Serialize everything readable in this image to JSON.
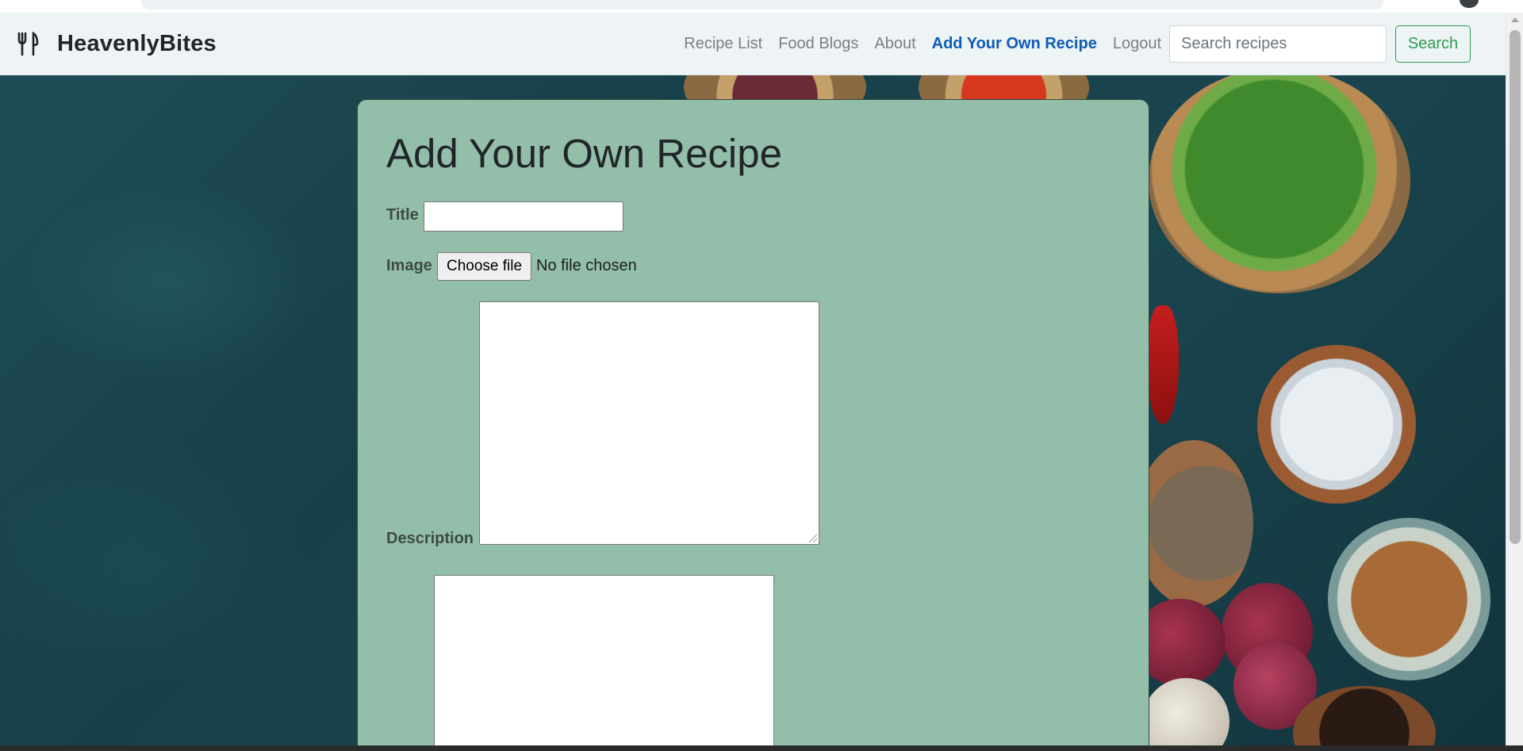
{
  "nav": {
    "brand_name": "HeavenlyBites",
    "brand_icon": "fork-knife-icon",
    "links": [
      {
        "label": "Recipe List"
      },
      {
        "label": "Food Blogs"
      },
      {
        "label": "About"
      },
      {
        "label": "Add Your Own Recipe",
        "active": true
      },
      {
        "label": "Logout"
      }
    ],
    "search_placeholder": "Search recipes",
    "search_value": "",
    "search_button": "Search"
  },
  "form": {
    "heading": "Add Your Own Recipe",
    "title_label": "Title",
    "title_value": "",
    "image_label": "Image",
    "choose_file_label": "Choose file",
    "no_file_text": "No file chosen",
    "description_label": "Description",
    "description_value": ""
  },
  "colors": {
    "card_bg": "#93bfaa",
    "active_link": "#0d5bb5",
    "search_button": "#2e9a52",
    "navbar_bg": "#eef3f6"
  }
}
